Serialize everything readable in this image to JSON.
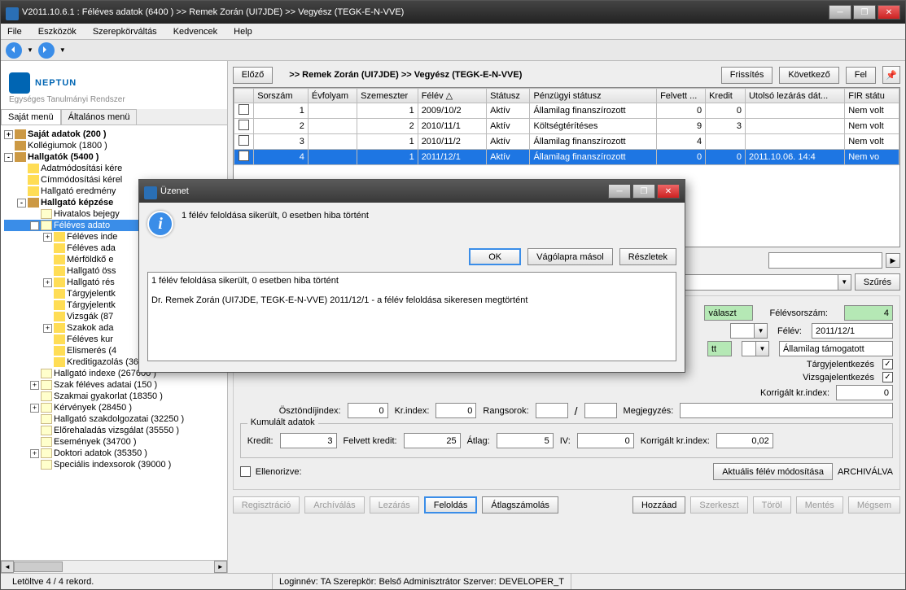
{
  "window": {
    "title": "V2011.10.6.1 : Féléves adatok (6400  )  >> Remek Zorán (UI7JDE) >> Vegyész (TEGK-E-N-VVE)"
  },
  "menu": [
    "File",
    "Eszközök",
    "Szerepkörváltás",
    "Kedvencek",
    "Help"
  ],
  "logo": {
    "main": "NEPTUN",
    "sub": "Egységes Tanulmányi Rendszer"
  },
  "side_tabs": {
    "a": "Saját menü",
    "b": "Általános menü"
  },
  "tree": [
    {
      "d": 0,
      "g": "+",
      "i": "book",
      "t": "Saját adatok (200  )",
      "b": 1
    },
    {
      "d": 0,
      "g": "",
      "i": "book",
      "t": "Kollégiumok (1800  )"
    },
    {
      "d": 0,
      "g": "-",
      "i": "book",
      "t": "Hallgatók (5400  )",
      "b": 1
    },
    {
      "d": 1,
      "g": "",
      "i": "folder",
      "t": "Adatmódosítási kére"
    },
    {
      "d": 1,
      "g": "",
      "i": "folder",
      "t": "Címmódosítási kérel"
    },
    {
      "d": 1,
      "g": "",
      "i": "folder",
      "t": "Hallgató eredmény"
    },
    {
      "d": 1,
      "g": "-",
      "i": "book",
      "t": "Hallgató képzése",
      "b": 1
    },
    {
      "d": 2,
      "g": "",
      "i": "page",
      "t": "Hivatalos bejegy"
    },
    {
      "d": 2,
      "g": "-",
      "i": "page",
      "t": "Féléves adato",
      "sel": 1
    },
    {
      "d": 3,
      "g": "+",
      "i": "folder",
      "t": "Féléves inde"
    },
    {
      "d": 3,
      "g": "",
      "i": "folder",
      "t": "Féléves ada"
    },
    {
      "d": 3,
      "g": "",
      "i": "folder",
      "t": "Mérföldkő e"
    },
    {
      "d": 3,
      "g": "",
      "i": "folder",
      "t": "Hallgató öss"
    },
    {
      "d": 3,
      "g": "+",
      "i": "folder",
      "t": "Hallgató rés"
    },
    {
      "d": 3,
      "g": "",
      "i": "folder",
      "t": "Tárgyjelentk"
    },
    {
      "d": 3,
      "g": "",
      "i": "folder",
      "t": "Tárgyjelentk"
    },
    {
      "d": 3,
      "g": "",
      "i": "folder",
      "t": "Vizsgák (87"
    },
    {
      "d": 3,
      "g": "+",
      "i": "folder",
      "t": "Szakok ada"
    },
    {
      "d": 3,
      "g": "",
      "i": "folder",
      "t": "Féléves kur"
    },
    {
      "d": 3,
      "g": "",
      "i": "folder",
      "t": "Elismerés (4"
    },
    {
      "d": 3,
      "g": "",
      "i": "folder",
      "t": "Kreditigazolás (36600  )"
    },
    {
      "d": 2,
      "g": "",
      "i": "page",
      "t": "Hallgató indexe (267600  )"
    },
    {
      "d": 2,
      "g": "+",
      "i": "page",
      "t": "Szak féléves adatai (150  )"
    },
    {
      "d": 2,
      "g": "",
      "i": "page",
      "t": "Szakmai gyakorlat (18350  )"
    },
    {
      "d": 2,
      "g": "+",
      "i": "page",
      "t": "Kérvények (28450  )"
    },
    {
      "d": 2,
      "g": "",
      "i": "page",
      "t": "Hallgató szakdolgozatai (32250  )"
    },
    {
      "d": 2,
      "g": "",
      "i": "page",
      "t": "Előrehaladás vizsgálat (35550  )"
    },
    {
      "d": 2,
      "g": "",
      "i": "page",
      "t": "Események (34700  )"
    },
    {
      "d": 2,
      "g": "+",
      "i": "page",
      "t": "Doktori adatok (35350  )"
    },
    {
      "d": 2,
      "g": "",
      "i": "page",
      "t": "Speciális indexsorok (39000  )"
    }
  ],
  "breadcrumb": ">> Remek Zorán (UI7JDE) >> Vegyész (TEGK-E-N-VVE)",
  "topbtns": {
    "prev": "Előző",
    "refresh": "Frissítés",
    "next": "Következő",
    "up": "Fel"
  },
  "grid": {
    "headers": [
      "",
      "Sorszám",
      "Évfolyam",
      "Szemeszter",
      "Félév",
      "Státusz",
      "Pénzügyi státusz",
      "Felvett ...",
      "Kredit",
      "Utolsó lezárás dát...",
      "FIR státu"
    ],
    "sort_arrow": "△",
    "rows": [
      {
        "cb": "",
        "sor": "1",
        "ev": "",
        "sz": "1",
        "felev": "2009/10/2",
        "st": "Aktív",
        "pst": "Államilag finanszírozott",
        "fk": "0",
        "kr": "0",
        "dt": "",
        "fir": "Nem volt"
      },
      {
        "cb": "",
        "sor": "2",
        "ev": "",
        "sz": "2",
        "felev": "2010/11/1",
        "st": "Aktív",
        "pst": "Költségtérítéses",
        "fk": "9",
        "kr": "3",
        "dt": "",
        "fir": "Nem volt"
      },
      {
        "cb": "",
        "sor": "3",
        "ev": "",
        "sz": "1",
        "felev": "2010/11/2",
        "st": "Aktív",
        "pst": "Államilag finanszírozott",
        "fk": "4",
        "kr": "",
        "dt": "",
        "fir": "Nem volt"
      },
      {
        "cb": "",
        "sor": "4",
        "ev": "",
        "sz": "1",
        "felev": "2011/12/1",
        "st": "Aktív",
        "pst": "Államilag finanszírozott",
        "fk": "0",
        "kr": "0",
        "dt": "2011.10.06. 14:4",
        "fir": "Nem vo",
        "sel": 1
      }
    ]
  },
  "filter_btn": "Szűrés",
  "form": {
    "valaszt": "választ",
    "fsorszam_l": "Félévsorszám:",
    "fsorszam_v": "4",
    "felev_l": "Félév:",
    "felev_v": "2011/12/1",
    "tt": "tt",
    "allamilag": "Államilag támogatott",
    "targy_l": "Tárgyjelentkezés",
    "vizsga_l": "Vizsgajelentkezés",
    "korr_l": "Korrigált kr.index:",
    "korr_v": "0",
    "osz_l": "Ösztöndíjindex:",
    "osz_v": "0",
    "krindex_l": "Kr.index:",
    "krindex_v": "0",
    "rang_l": "Rangsorok:",
    "rang_v1": "",
    "rang_v2": "",
    "megj_l": "Megjegyzés:",
    "kumul": "Kumulált adatok",
    "kredit_l": "Kredit:",
    "kredit_v": "3",
    "fkredit_l": "Felvett kredit:",
    "fkredit_v": "25",
    "atlag_l": "Átlag:",
    "atlag_v": "5",
    "iv_l": "IV:",
    "iv_v": "0",
    "korr2_l": "Korrigált kr.index:",
    "korr2_v": "0,02",
    "ellen_l": "Ellenorizve:",
    "aktualis": "Aktuális félév módosítása",
    "archivalva": "ARCHIVÁLVA"
  },
  "bottom_btns": {
    "reg": "Regisztráció",
    "arch": "Archíválás",
    "lez": "Lezárás",
    "fel": "Feloldás",
    "atl": "Átlagszámolás",
    "add": "Hozzáad",
    "edit": "Szerkeszt",
    "del": "Töröl",
    "save": "Mentés",
    "cancel": "Mégsem"
  },
  "status": {
    "rec": "Letöltve 4 / 4 rekord.",
    "login": "Loginnév: TA   Szerepkör: Belső Adminisztrátor   Szerver: DEVELOPER_T"
  },
  "modal": {
    "title": "Üzenet",
    "msg": "1 félév feloldása sikerült, 0 esetben hiba történt",
    "ok": "OK",
    "copy": "Vágólapra másol",
    "detail": "Részletek",
    "detail_text": "1 félév feloldása sikerült, 0 esetben hiba történt\n\nDr. Remek Zorán (UI7JDE, TEGK-E-N-VVE) 2011/12/1 - a félév feloldása sikeresen megtörtént"
  }
}
